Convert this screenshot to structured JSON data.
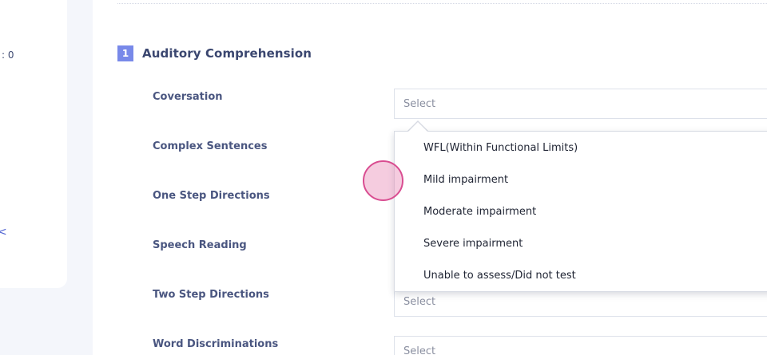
{
  "left_panel": {
    "fragment_1": ": 0",
    "fragment_2": "<"
  },
  "section": {
    "number": "1",
    "title": "Auditory Comprehension"
  },
  "questions": [
    {
      "label": "Coversation",
      "select_value": "Select"
    },
    {
      "label": "Complex Sentences",
      "select_value": ""
    },
    {
      "label": "One Step Directions",
      "select_value": ""
    },
    {
      "label": "Speech Reading",
      "select_value": ""
    },
    {
      "label": "Two Step Directions",
      "select_value": "Select"
    },
    {
      "label": "Word Discriminations",
      "select_value": "Select"
    }
  ],
  "dropdown": {
    "options": [
      "WFL(Within Functional Limits)",
      "Mild impairment",
      "Moderate impairment",
      "Severe impairment",
      "Unable to assess/Did not test"
    ]
  },
  "colors": {
    "accent": "#7889e9",
    "touch_indicator": "#d94d91"
  }
}
